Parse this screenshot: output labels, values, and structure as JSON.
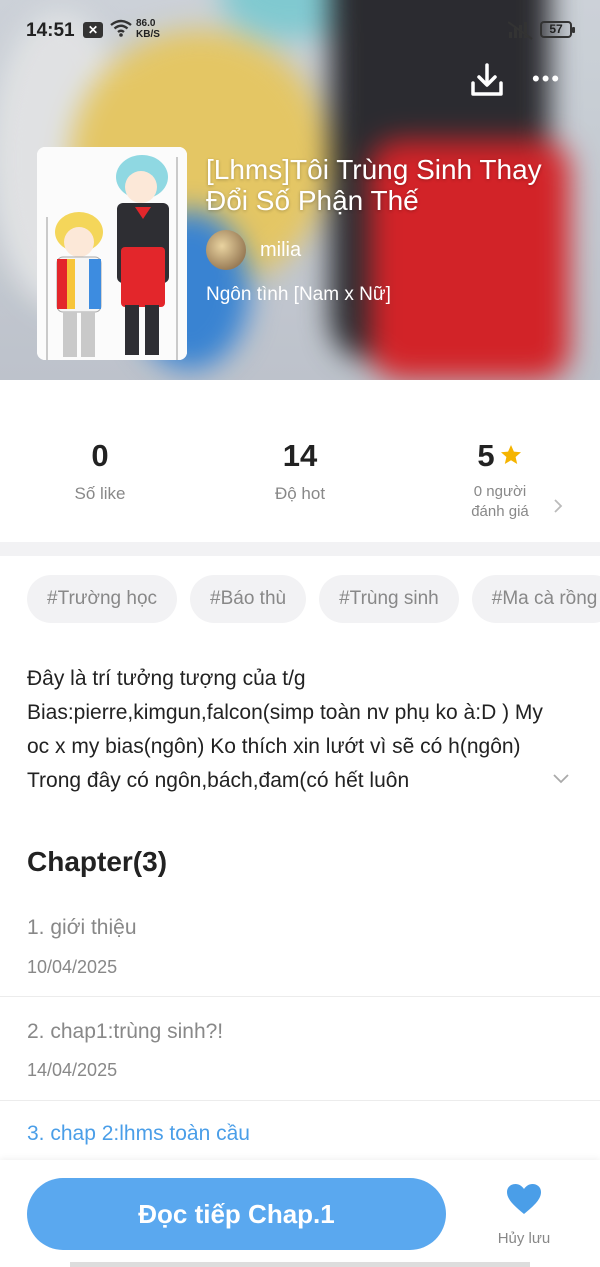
{
  "status_bar": {
    "time": "14:51",
    "notif_icon": "x-box-icon",
    "speed_value": "86.0",
    "speed_unit": "KB/S",
    "battery": "57"
  },
  "header": {
    "title": "[Lhms]Tôi Trùng Sinh Thay Đổi Số Phận Thế",
    "author": "milia",
    "genre": "Ngôn tình [Nam x Nữ]"
  },
  "stats": {
    "likes_value": "0",
    "likes_label": "Số like",
    "hot_value": "14",
    "hot_label": "Độ hot",
    "rating_value": "5",
    "rating_label": "0 người đánh giá"
  },
  "tags": [
    "#Trường học",
    "#Báo thù",
    "#Trùng sinh",
    "#Ma cà rồng"
  ],
  "description": "Đây là trí tưởng tượng của t/g Bias:pierre,kimgun,falcon(simp toàn nv phụ ko à:D ) My oc x my bias(ngôn) Ko thích xin lướt vì sẽ có h(ngôn) Trong đây có ngôn,bách,đam(có hết luôn",
  "chapters": {
    "heading": "Chapter(3)",
    "items": [
      {
        "name": "1. giới thiệu",
        "date": "10/04/2025"
      },
      {
        "name": "2. chap1:trùng sinh?!",
        "date": "14/04/2025"
      },
      {
        "name": "3. chap 2:lhms toàn cầu",
        "date": ""
      }
    ]
  },
  "bottom": {
    "read_button": "Đọc tiếp Chap.1",
    "save_label": "Hủy lưu"
  },
  "colors": {
    "accent": "#5aa8ef",
    "star": "#f5b400",
    "heart": "#4a9ee8"
  }
}
